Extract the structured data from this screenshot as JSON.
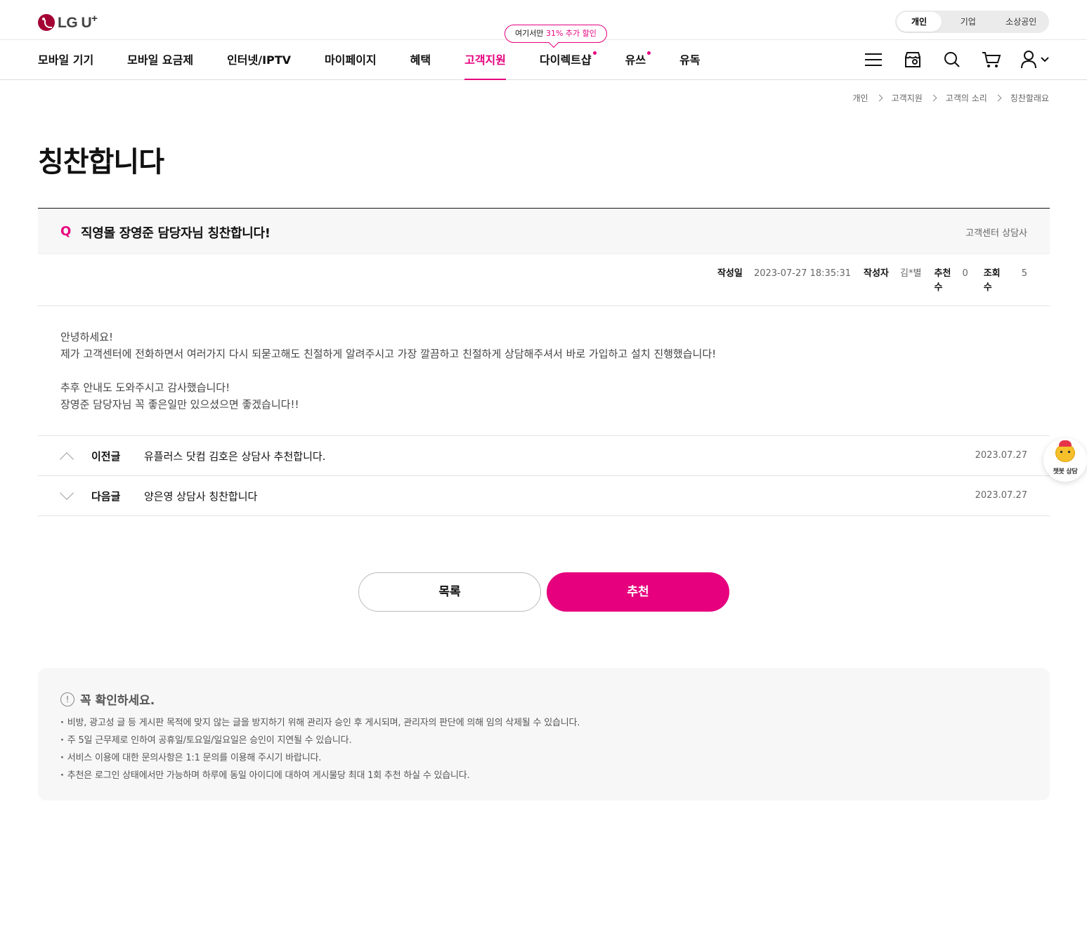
{
  "brand": {
    "logo_text": "LG U",
    "logo_sup": "+"
  },
  "segment": {
    "items": [
      "개인",
      "기업",
      "소상공인"
    ],
    "active": "개인"
  },
  "gnb": {
    "items": [
      {
        "label": "모바일 기기"
      },
      {
        "label": "모바일 요금제"
      },
      {
        "label": "인터넷/IPTV"
      },
      {
        "label": "마이페이지"
      },
      {
        "label": "혜택"
      },
      {
        "label": "고객지원"
      },
      {
        "label": "다이렉트샵"
      },
      {
        "label": "유쓰"
      },
      {
        "label": "유독"
      }
    ],
    "active": "고객지원",
    "promo": {
      "prefix": "여기서만 ",
      "highlight": "31% 추가 할인"
    },
    "icons": [
      "menu-icon",
      "store-location-icon",
      "search-icon",
      "cart-icon",
      "user-icon"
    ]
  },
  "breadcrumb": [
    "개인",
    "고객지원",
    "고객의 소리",
    "칭찬할래요"
  ],
  "page_title": "칭찬합니다",
  "post": {
    "q_mark": "Q",
    "title": "직영몰 장영준 담당자님 칭찬합니다!",
    "category": "고객센터 상담사",
    "meta": {
      "date_label": "작성일",
      "date": "2023-07-27 18:35:31",
      "author_label": "작성자",
      "author": "김*별",
      "recommend_label": "추천수",
      "recommend": "0",
      "views_label": "조회수",
      "views": "5"
    },
    "body": "안녕하세요!\n제가 고객센터에 전화하면서 여러가지 다시 되묻고해도 친절하게 알려주시고 가장 깔끔하고 친절하게 상담해주셔서 바로 가입하고 설치 진행했습니다!\n\n추후 안내도 도와주시고 감사했습니다!\n장영준 담당자님 꼭 좋은일만 있으셨으면 좋겠습니다!!"
  },
  "prev": {
    "label": "이전글",
    "title": "유플러스 닷컴 김호은 상담사 추천합니다.",
    "date": "2023.07.27"
  },
  "next": {
    "label": "다음글",
    "title": "양은영 상담사 칭찬합니다",
    "date": "2023.07.27"
  },
  "buttons": {
    "list": "목록",
    "recommend": "추천"
  },
  "notice": {
    "title": "꼭 확인하세요.",
    "icon": "!",
    "items": [
      "비방, 광고성 글 등 게시판 목적에 맞지 않는 글을 방지하기 위해 관리자 승인 후 게시되며, 관리자의 판단에 의해 임의 삭제될 수 있습니다.",
      "주 5일 근무제로 인하여 공휴일/토요일/일요일은 승인이 지연될 수 있습니다.",
      "서비스 이용에 대한 문의사항은 1:1 문의를 이용해 주시기 바랍니다.",
      "추천은 로그인 상태에서만 가능하며 하루에 동일 아이디에 대하여 게시물당 최대 1회 추천 하실 수 있습니다."
    ]
  },
  "chatbot": {
    "label": "챗봇 상담"
  },
  "colors": {
    "accent": "#e6007e",
    "brand": "#a50034"
  }
}
